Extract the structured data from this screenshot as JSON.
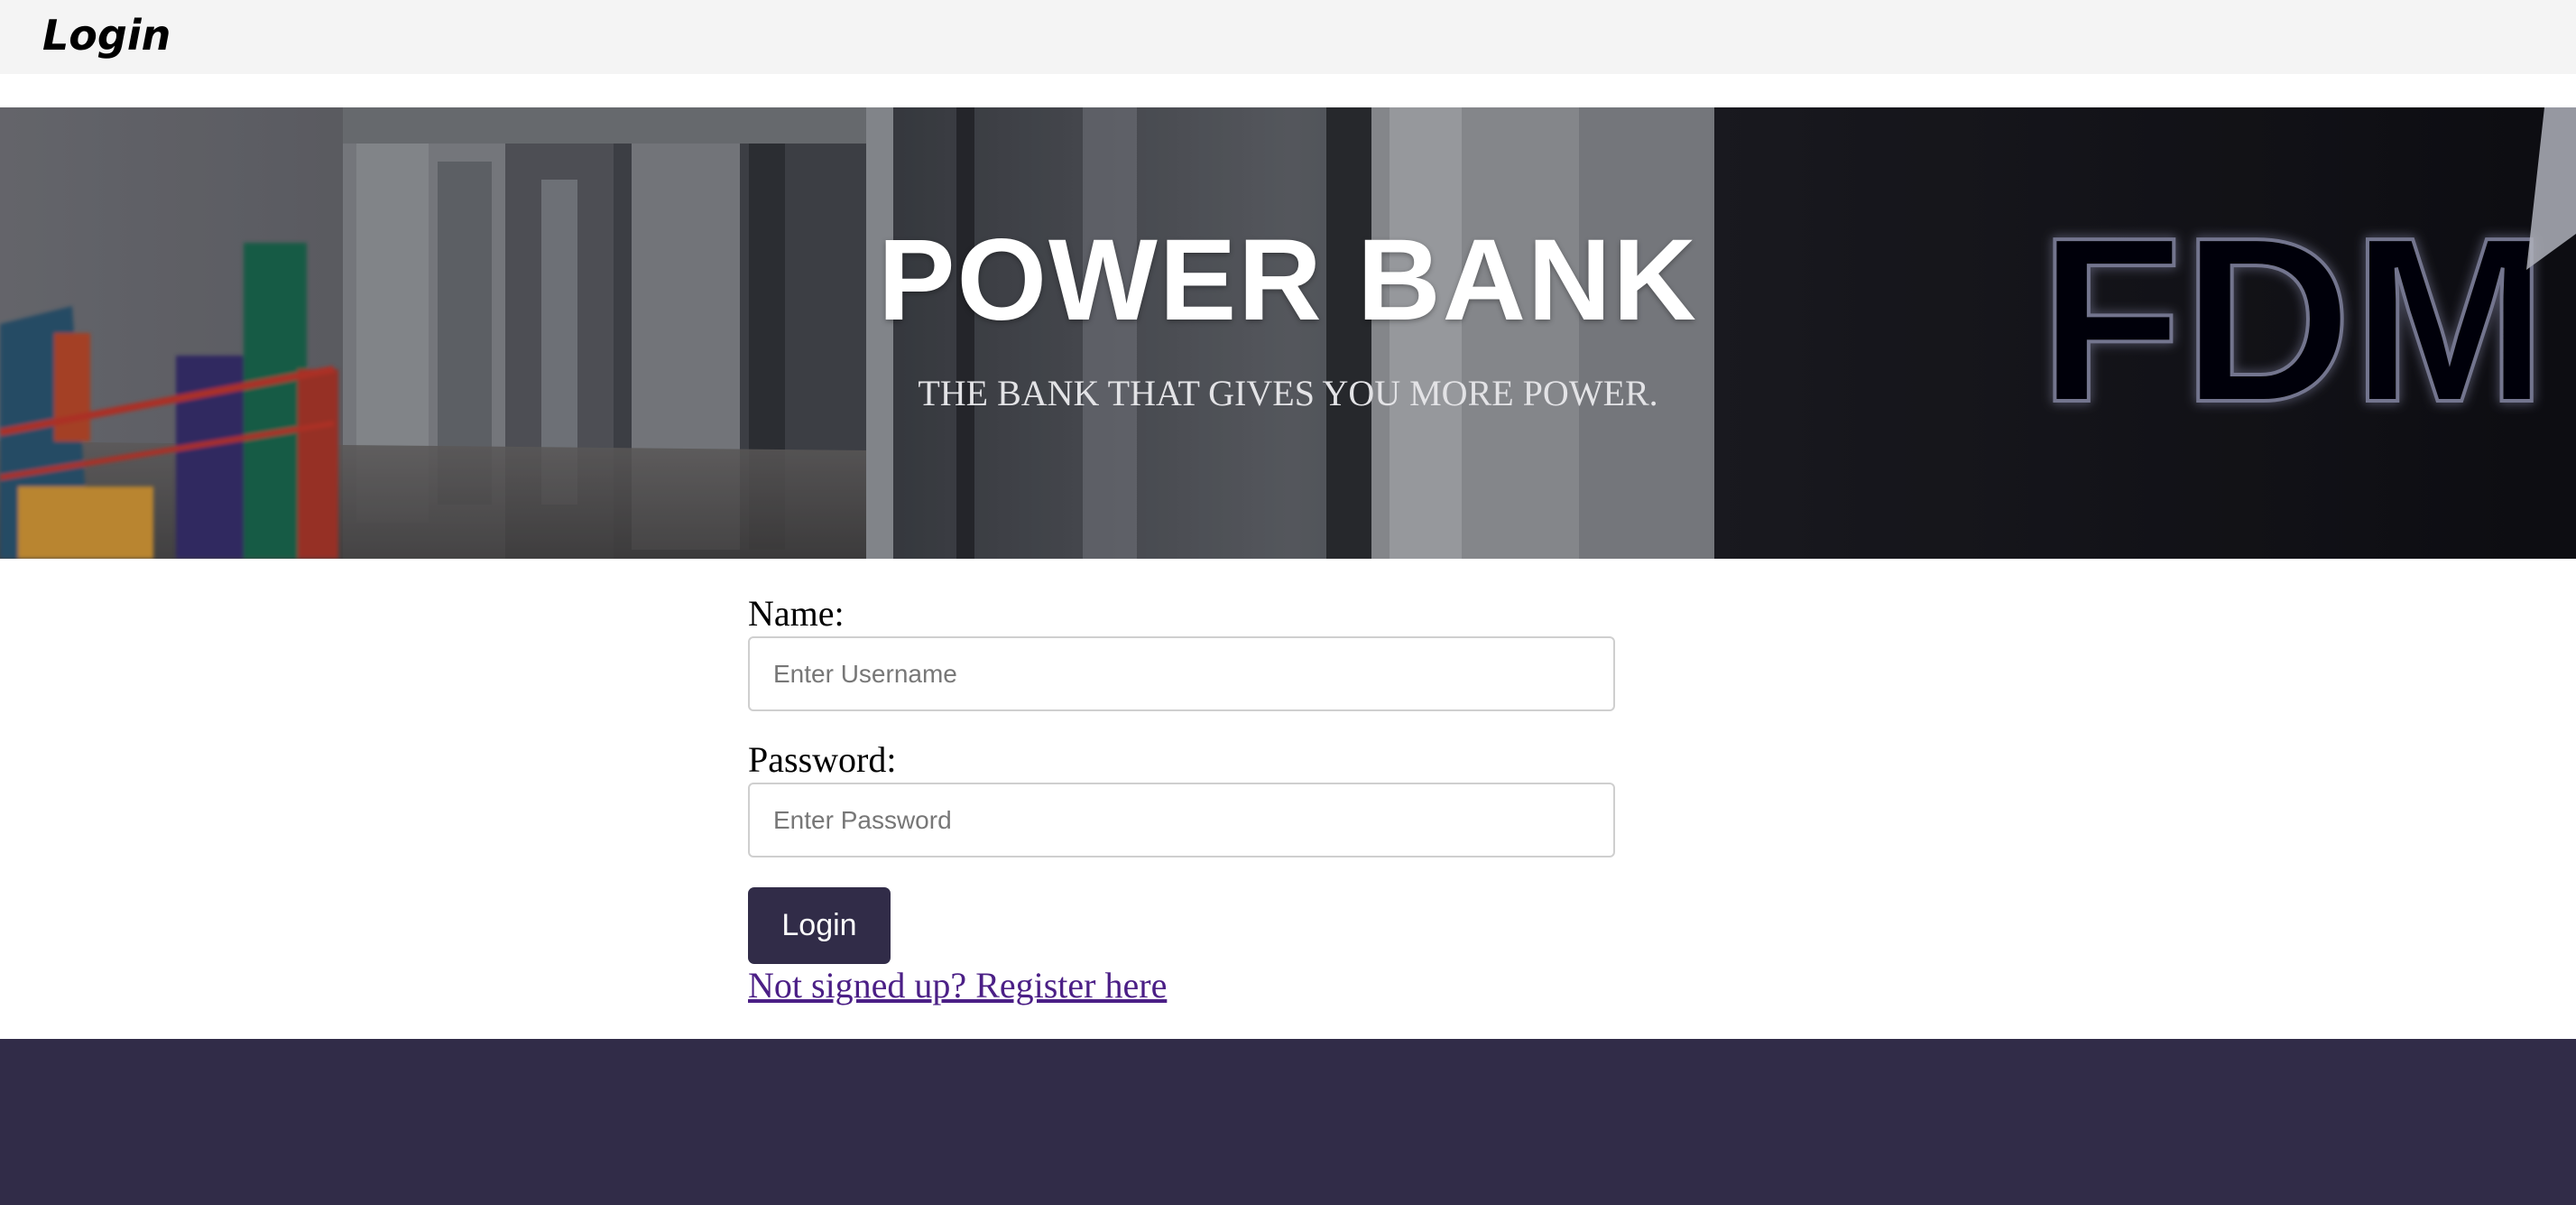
{
  "header": {
    "title": "Login"
  },
  "hero": {
    "title": "POWER BANK",
    "subtitle": "THE BANK THAT GIVES YOU MORE POWER.",
    "sign_text": "FDM"
  },
  "form": {
    "name_label": "Name:",
    "name_placeholder": "Enter Username",
    "password_label": "Password:",
    "password_placeholder": "Enter Password",
    "submit_label": "Login",
    "register_link": "Not signed up? Register here"
  },
  "colors": {
    "brand_dark": "#312c48",
    "link": "#4b1f86",
    "header_bg": "#f4f4f4"
  }
}
